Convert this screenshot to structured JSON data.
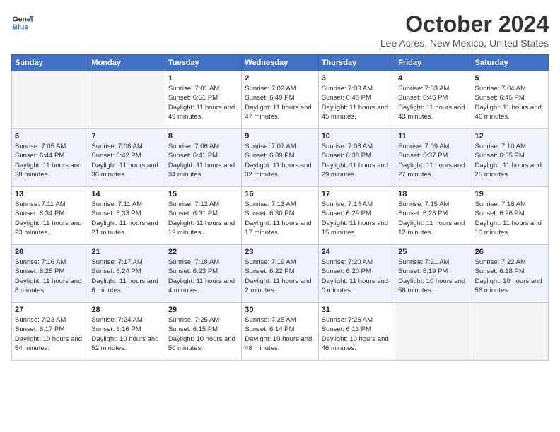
{
  "header": {
    "logo_line1": "General",
    "logo_line2": "Blue",
    "title": "October 2024",
    "location": "Lee Acres, New Mexico, United States"
  },
  "days_of_week": [
    "Sunday",
    "Monday",
    "Tuesday",
    "Wednesday",
    "Thursday",
    "Friday",
    "Saturday"
  ],
  "weeks": [
    {
      "days": [
        {
          "num": "",
          "empty": true
        },
        {
          "num": "",
          "empty": true
        },
        {
          "num": "1",
          "info": "Sunrise: 7:01 AM\nSunset: 6:51 PM\nDaylight: 11 hours and 49 minutes."
        },
        {
          "num": "2",
          "info": "Sunrise: 7:02 AM\nSunset: 6:49 PM\nDaylight: 11 hours and 47 minutes."
        },
        {
          "num": "3",
          "info": "Sunrise: 7:03 AM\nSunset: 6:48 PM\nDaylight: 11 hours and 45 minutes."
        },
        {
          "num": "4",
          "info": "Sunrise: 7:03 AM\nSunset: 6:46 PM\nDaylight: 11 hours and 43 minutes."
        },
        {
          "num": "5",
          "info": "Sunrise: 7:04 AM\nSunset: 6:45 PM\nDaylight: 11 hours and 40 minutes."
        }
      ]
    },
    {
      "days": [
        {
          "num": "6",
          "info": "Sunrise: 7:05 AM\nSunset: 6:44 PM\nDaylight: 11 hours and 38 minutes."
        },
        {
          "num": "7",
          "info": "Sunrise: 7:06 AM\nSunset: 6:42 PM\nDaylight: 11 hours and 36 minutes."
        },
        {
          "num": "8",
          "info": "Sunrise: 7:06 AM\nSunset: 6:41 PM\nDaylight: 11 hours and 34 minutes."
        },
        {
          "num": "9",
          "info": "Sunrise: 7:07 AM\nSunset: 6:39 PM\nDaylight: 11 hours and 32 minutes."
        },
        {
          "num": "10",
          "info": "Sunrise: 7:08 AM\nSunset: 6:38 PM\nDaylight: 11 hours and 29 minutes."
        },
        {
          "num": "11",
          "info": "Sunrise: 7:09 AM\nSunset: 6:37 PM\nDaylight: 11 hours and 27 minutes."
        },
        {
          "num": "12",
          "info": "Sunrise: 7:10 AM\nSunset: 6:35 PM\nDaylight: 11 hours and 25 minutes."
        }
      ]
    },
    {
      "days": [
        {
          "num": "13",
          "info": "Sunrise: 7:11 AM\nSunset: 6:34 PM\nDaylight: 11 hours and 23 minutes."
        },
        {
          "num": "14",
          "info": "Sunrise: 7:11 AM\nSunset: 6:33 PM\nDaylight: 11 hours and 21 minutes."
        },
        {
          "num": "15",
          "info": "Sunrise: 7:12 AM\nSunset: 6:31 PM\nDaylight: 11 hours and 19 minutes."
        },
        {
          "num": "16",
          "info": "Sunrise: 7:13 AM\nSunset: 6:30 PM\nDaylight: 11 hours and 17 minutes."
        },
        {
          "num": "17",
          "info": "Sunrise: 7:14 AM\nSunset: 6:29 PM\nDaylight: 11 hours and 15 minutes."
        },
        {
          "num": "18",
          "info": "Sunrise: 7:15 AM\nSunset: 6:28 PM\nDaylight: 11 hours and 12 minutes."
        },
        {
          "num": "19",
          "info": "Sunrise: 7:16 AM\nSunset: 6:26 PM\nDaylight: 11 hours and 10 minutes."
        }
      ]
    },
    {
      "days": [
        {
          "num": "20",
          "info": "Sunrise: 7:16 AM\nSunset: 6:25 PM\nDaylight: 11 hours and 8 minutes."
        },
        {
          "num": "21",
          "info": "Sunrise: 7:17 AM\nSunset: 6:24 PM\nDaylight: 11 hours and 6 minutes."
        },
        {
          "num": "22",
          "info": "Sunrise: 7:18 AM\nSunset: 6:23 PM\nDaylight: 11 hours and 4 minutes."
        },
        {
          "num": "23",
          "info": "Sunrise: 7:19 AM\nSunset: 6:22 PM\nDaylight: 11 hours and 2 minutes."
        },
        {
          "num": "24",
          "info": "Sunrise: 7:20 AM\nSunset: 6:20 PM\nDaylight: 11 hours and 0 minutes."
        },
        {
          "num": "25",
          "info": "Sunrise: 7:21 AM\nSunset: 6:19 PM\nDaylight: 10 hours and 58 minutes."
        },
        {
          "num": "26",
          "info": "Sunrise: 7:22 AM\nSunset: 6:18 PM\nDaylight: 10 hours and 56 minutes."
        }
      ]
    },
    {
      "days": [
        {
          "num": "27",
          "info": "Sunrise: 7:23 AM\nSunset: 6:17 PM\nDaylight: 10 hours and 54 minutes."
        },
        {
          "num": "28",
          "info": "Sunrise: 7:24 AM\nSunset: 6:16 PM\nDaylight: 10 hours and 52 minutes."
        },
        {
          "num": "29",
          "info": "Sunrise: 7:25 AM\nSunset: 6:15 PM\nDaylight: 10 hours and 50 minutes."
        },
        {
          "num": "30",
          "info": "Sunrise: 7:25 AM\nSunset: 6:14 PM\nDaylight: 10 hours and 48 minutes."
        },
        {
          "num": "31",
          "info": "Sunrise: 7:26 AM\nSunset: 6:13 PM\nDaylight: 10 hours and 46 minutes."
        },
        {
          "num": "",
          "empty": true
        },
        {
          "num": "",
          "empty": true
        }
      ]
    }
  ]
}
